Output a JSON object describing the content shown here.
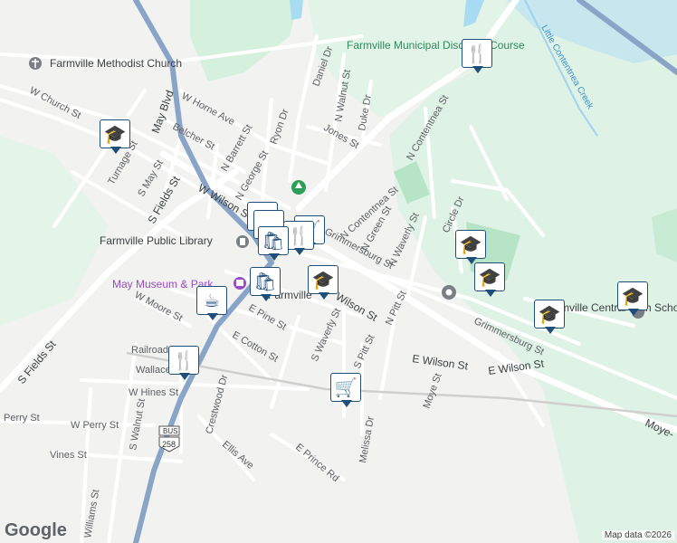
{
  "map": {
    "attribution": "Map data ©2026",
    "logo": "Google",
    "colors": {
      "background": "#f2f3f1",
      "park": "#c8ebd4",
      "water": "#9fd3f0",
      "road": "#ffffff",
      "highway": "#8aa4c8",
      "rail": "#c9c9c9",
      "marker": "#1f4e79"
    }
  },
  "places": {
    "methodist_church": "Farmville Methodist Church",
    "disc_golf": "Farmville Municipal Disc Golf Course",
    "library": "Farmville Public Library",
    "museum": "May Museum & Park",
    "farmville": "Farmville",
    "central_high": "Farmville Central High School",
    "creek": "Little Contentnea Creek"
  },
  "streets": {
    "w_church": "W Church St",
    "may_blvd": "May Blvd",
    "w_horne": "W Horne Ave",
    "belcher": "Belcher St",
    "turnage": "Turnage St",
    "s_may": "S May St",
    "s_fields": "S Fields St",
    "s_fields2": "S Fields St",
    "w_wilson": "W Wilson St",
    "n_barrett": "N Barrett St",
    "n_george": "N George St",
    "ryon": "Ryon Dr",
    "daniel": "Daniel Dr",
    "n_walnut": "N Walnut St",
    "duke": "Duke Dr",
    "jones": "Jones St",
    "n_contentnea": "N Contentnea St",
    "n_contentnea2": "N Contentnea St",
    "grimmersburg": "Grimmersburg St",
    "grimmersburg2": "Grimmersburg St",
    "n_green": "N Green St",
    "n_waverly": "N Waverly St",
    "circle": "Circle Dr",
    "w_moore": "W Moore St",
    "e_pine": "E Pine St",
    "e_cotton": "E Cotton St",
    "wilson": "Wilson St",
    "s_waverly": "S Waverly St",
    "n_pitt": "N Pitt St",
    "s_pitt": "S Pitt St",
    "e_wilson": "E Wilson St",
    "e_wilson2": "E Wilson St",
    "railroad": "Railroad",
    "wallace": "Wallace",
    "w_hines": "W Hines St",
    "crestwood": "Crestwood Dr",
    "perry": "Perry St",
    "w_perry": "W Perry St",
    "s_walnut": "S Walnut St",
    "vines": "Vines St",
    "ellis": "Ellis Ave",
    "e_prince": "E Prince Rd",
    "melissa": "Melissa Dr",
    "moye": "Moye St",
    "moye2": "Moye-",
    "williams": "Williams St",
    "bus": "BUS",
    "route": "258"
  },
  "markers": [
    {
      "id": "school-1",
      "icon": "graduation-cap-icon",
      "glyph": "🎓"
    },
    {
      "id": "restaurant-1",
      "icon": "fork-knife-icon",
      "glyph": "🍴"
    },
    {
      "id": "school-2",
      "icon": "graduation-cap-icon",
      "glyph": "🎓"
    },
    {
      "id": "school-3",
      "icon": "graduation-cap-icon",
      "glyph": "🎓"
    },
    {
      "id": "school-4",
      "icon": "graduation-cap-icon",
      "glyph": "🎓"
    },
    {
      "id": "school-5",
      "icon": "graduation-cap-icon",
      "glyph": "🎓"
    },
    {
      "id": "school-6",
      "icon": "graduation-cap-icon",
      "glyph": "🎓"
    },
    {
      "id": "shopping-1",
      "icon": "shopping-bag-icon",
      "glyph": "🛍"
    },
    {
      "id": "restaurant-2",
      "icon": "fork-knife-icon",
      "glyph": "🍴"
    },
    {
      "id": "shopping-2",
      "icon": "shopping-bag-icon",
      "glyph": "🛍"
    },
    {
      "id": "cafe-1",
      "icon": "coffee-cup-icon",
      "glyph": "☕"
    },
    {
      "id": "restaurant-3",
      "icon": "fork-knife-icon",
      "glyph": "🍴"
    },
    {
      "id": "grocery-1",
      "icon": "shopping-cart-icon",
      "glyph": "🛒"
    }
  ]
}
